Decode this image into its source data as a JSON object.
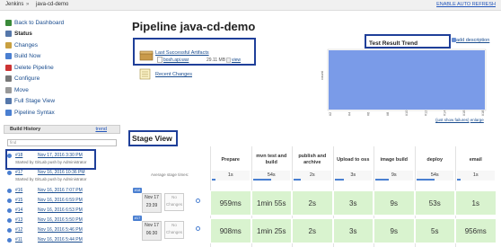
{
  "breadcrumb": {
    "root": "Jenkins",
    "sep": "»",
    "job": "java-cd-demo"
  },
  "auto_refresh": "ENABLE AUTO REFRESH",
  "sidebar": {
    "items": [
      {
        "label": "Back to Dashboard",
        "icon": "arrow-up-icon",
        "color": "#3a8a3a"
      },
      {
        "label": "Status",
        "icon": "magnifier-icon",
        "color": "#5577aa"
      },
      {
        "label": "Changes",
        "icon": "notepad-icon",
        "color": "#c9a040"
      },
      {
        "label": "Build Now",
        "icon": "clock-icon",
        "color": "#4a7fd1"
      },
      {
        "label": "Delete Pipeline",
        "icon": "no-entry-icon",
        "color": "#cc3333"
      },
      {
        "label": "Configure",
        "icon": "gear-icon",
        "color": "#777777"
      },
      {
        "label": "Move",
        "icon": "move-icon",
        "color": "#999999"
      },
      {
        "label": "Full Stage View",
        "icon": "magnifier-icon",
        "color": "#5577aa"
      },
      {
        "label": "Pipeline Syntax",
        "icon": "help-icon",
        "color": "#4a7fd1"
      }
    ]
  },
  "build_history": {
    "title": "Build History",
    "trend": "trend",
    "filter_placeholder": "find",
    "builds": [
      {
        "num": "#18",
        "date": "Nov 17, 2016 3:30 PM",
        "sub": "Started by GitLab push by Administrator"
      },
      {
        "num": "#17",
        "date": "Nov 16, 2016 10:36 PM",
        "sub": "Started by GitLab push by Administrator"
      },
      {
        "num": "#16",
        "date": "Nov 16, 2016 7:07 PM",
        "sub": ""
      },
      {
        "num": "#15",
        "date": "Nov 16, 2016 6:59 PM",
        "sub": ""
      },
      {
        "num": "#14",
        "date": "Nov 16, 2016 6:53 PM",
        "sub": ""
      },
      {
        "num": "#13",
        "date": "Nov 16, 2016 5:50 PM",
        "sub": ""
      },
      {
        "num": "#12",
        "date": "Nov 16, 2016 5:46 PM",
        "sub": ""
      },
      {
        "num": "#11",
        "date": "Nov 16, 2016 5:44 PM",
        "sub": ""
      }
    ]
  },
  "main": {
    "title": "Pipeline java-cd-demo",
    "artifacts": {
      "title": "Last Successful Artifacts",
      "file": "bosh.api.war",
      "size": "29.11 MB",
      "view": "view"
    },
    "recent_changes": "Recent Changes"
  },
  "trend_chart": {
    "title": "Test Result Trend",
    "add_description": "add description",
    "ylabel": "count",
    "show_failures": "(just show failures)",
    "enlarge": "enlarge",
    "fill_color": "#7a9be8",
    "x_labels": [
      "#2",
      "#4",
      "#6",
      "#8",
      "#10",
      "#12",
      "#14",
      "#16",
      "#18"
    ]
  },
  "stage_view": {
    "title": "Stage View",
    "avg_label": "Average stage times:",
    "stages": [
      {
        "name": "Prepare",
        "avg": "1s",
        "avg_fraction": 0.1
      },
      {
        "name": "mvn test and build",
        "avg": "54s",
        "avg_fraction": 0.5
      },
      {
        "name": "publish and archive",
        "avg": "2s",
        "avg_fraction": 0.2
      },
      {
        "name": "Upload to oss",
        "avg": "3s",
        "avg_fraction": 0.25
      },
      {
        "name": "image build",
        "avg": "9s",
        "avg_fraction": 0.35
      },
      {
        "name": "deploy",
        "avg": "54s",
        "avg_fraction": 0.5
      },
      {
        "name": "email",
        "avg": "1s",
        "avg_fraction": 0.1
      }
    ],
    "runs": [
      {
        "tag": "#18",
        "month_day": "Nov 17",
        "time": "23:39",
        "changes": "No Changes",
        "values": [
          "959ms",
          "1min 55s",
          "2s",
          "3s",
          "9s",
          "53s",
          "1s"
        ]
      },
      {
        "tag": "#17",
        "month_day": "Nov 17",
        "time": "06:30",
        "changes": "No Changes",
        "values": [
          "908ms",
          "1min 25s",
          "2s",
          "3s",
          "9s",
          "5s",
          "956ms"
        ]
      }
    ]
  }
}
